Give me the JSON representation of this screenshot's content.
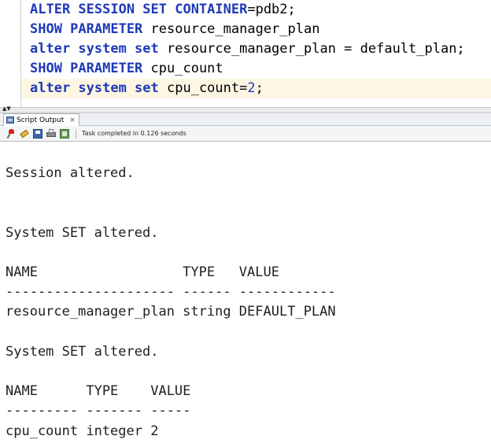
{
  "editor": {
    "lines": [
      [
        {
          "t": "ALTER SESSION SET CONTAINER",
          "c": "kw"
        },
        {
          "t": "=pdb2;",
          "c": ""
        }
      ],
      [
        {
          "t": "SHOW PARAMETER",
          "c": "kw"
        },
        {
          "t": " resource_manager_plan",
          "c": ""
        }
      ],
      [
        {
          "t": "alter system set",
          "c": "kw"
        },
        {
          "t": " resource_manager_plan = default_plan;",
          "c": ""
        }
      ],
      [
        {
          "t": "SHOW PARAMETER",
          "c": "kw"
        },
        {
          "t": " cpu_count",
          "c": ""
        }
      ],
      [
        {
          "t": "alter system set",
          "c": "kw"
        },
        {
          "t": " cpu_count=",
          "c": ""
        },
        {
          "t": "2",
          "c": "num"
        },
        {
          "t": ";",
          "c": ""
        }
      ]
    ],
    "current_line": 4
  },
  "panel": {
    "tab_label": "Script Output",
    "tab_close": "×"
  },
  "toolbar": {
    "status": "Task completed in 0.126 seconds"
  },
  "output": {
    "lines": [
      "Session altered.",
      "",
      "",
      "System SET altered.",
      "",
      "NAME                  TYPE   VALUE",
      "--------------------- ------ ------------",
      "resource_manager_plan string DEFAULT_PLAN",
      "",
      "System SET altered.",
      "",
      "NAME      TYPE    VALUE",
      "--------- ------- -----",
      "cpu_count integer 2"
    ]
  }
}
